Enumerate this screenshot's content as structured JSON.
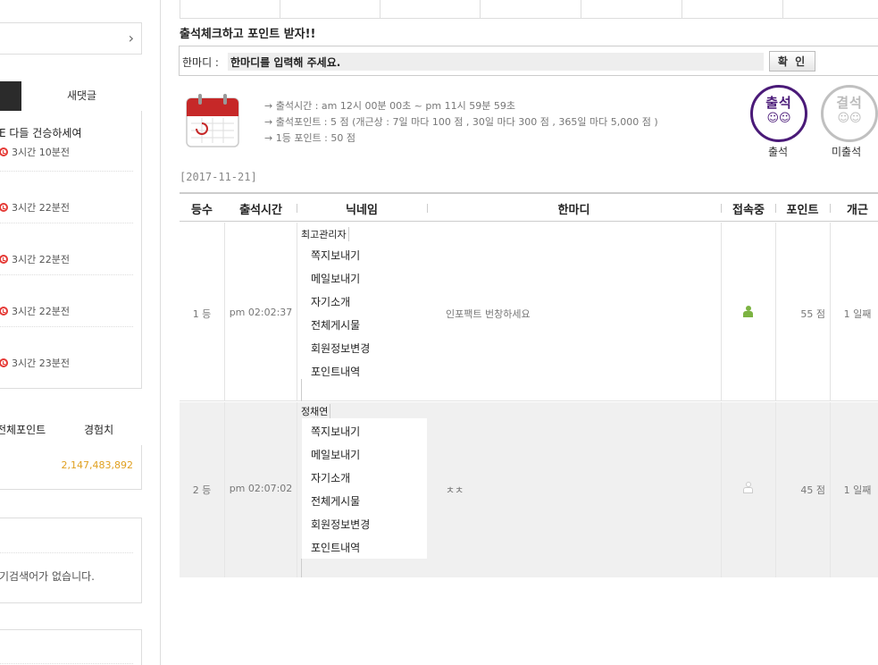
{
  "sidebar": {
    "tabs": [
      {
        "label": ""
      },
      {
        "label": "새댓글"
      }
    ],
    "comments": [
      {
        "text": "E 다들 건승하세여",
        "time": "3시간 10분전"
      },
      {
        "text": "",
        "time": "3시간 22분전"
      },
      {
        "text": "",
        "time": "3시간 22분전"
      },
      {
        "text": "",
        "time": "3시간 22분전"
      },
      {
        "text": "",
        "time": "3시간 23분전"
      }
    ],
    "points_header": {
      "left": "전체포인트",
      "right": "경험치"
    },
    "points_value": "2,147,483,892",
    "popular_search_empty": "기검색어가 없습니다.",
    "arrow_glyph": "›"
  },
  "attendance": {
    "title": "출석체크하고 포인트 받자!!",
    "comment_label": "한마디 :",
    "comment_value": "한마디를 입력해 주세요.",
    "confirm_label": "확 인",
    "info": [
      "→ 출석시간 : am 12시 00분 00초 ~ pm 11시 59분 59초",
      "→ 출석포인트 : 5 점 (개근상 : 7일 마다 100 점 , 30일 마다 300 점 , 365일 마다 5,000 점 )",
      "→ 1등 포인트 : 50 점"
    ],
    "stamps": [
      {
        "stamp_text": "출석",
        "label": "출석"
      },
      {
        "stamp_text": "결석",
        "label": "미출석"
      }
    ],
    "date": "[2017-11-21]"
  },
  "table": {
    "headers": [
      "등수",
      "출석시간",
      "닉네임",
      "한마디",
      "접속중",
      "포인트",
      "개근"
    ],
    "member_menu": [
      "쪽지보내기",
      "메일보내기",
      "자기소개",
      "전체게시물",
      "회원정보변경",
      "포인트내역"
    ],
    "rows": [
      {
        "rank": "1 등",
        "time": "pm 02:02:37",
        "nickname": "최고관리자",
        "comment": "인포팩트 번창하세요",
        "online": true,
        "points": "55 점",
        "streak": "1 일째"
      },
      {
        "rank": "2 등",
        "time": "pm 02:07:02",
        "nickname": "정채연",
        "comment": "ㅊㅊ",
        "online": false,
        "points": "45 점",
        "streak": "1 일째"
      }
    ]
  },
  "colors": {
    "accent_red": "#e53935",
    "stamp_purple": "#4a1a78",
    "stamp_gray": "#c0c0c0",
    "online_green": "#7cb342",
    "offline_gray": "#cccccc",
    "points_orange": "#e0a020"
  }
}
